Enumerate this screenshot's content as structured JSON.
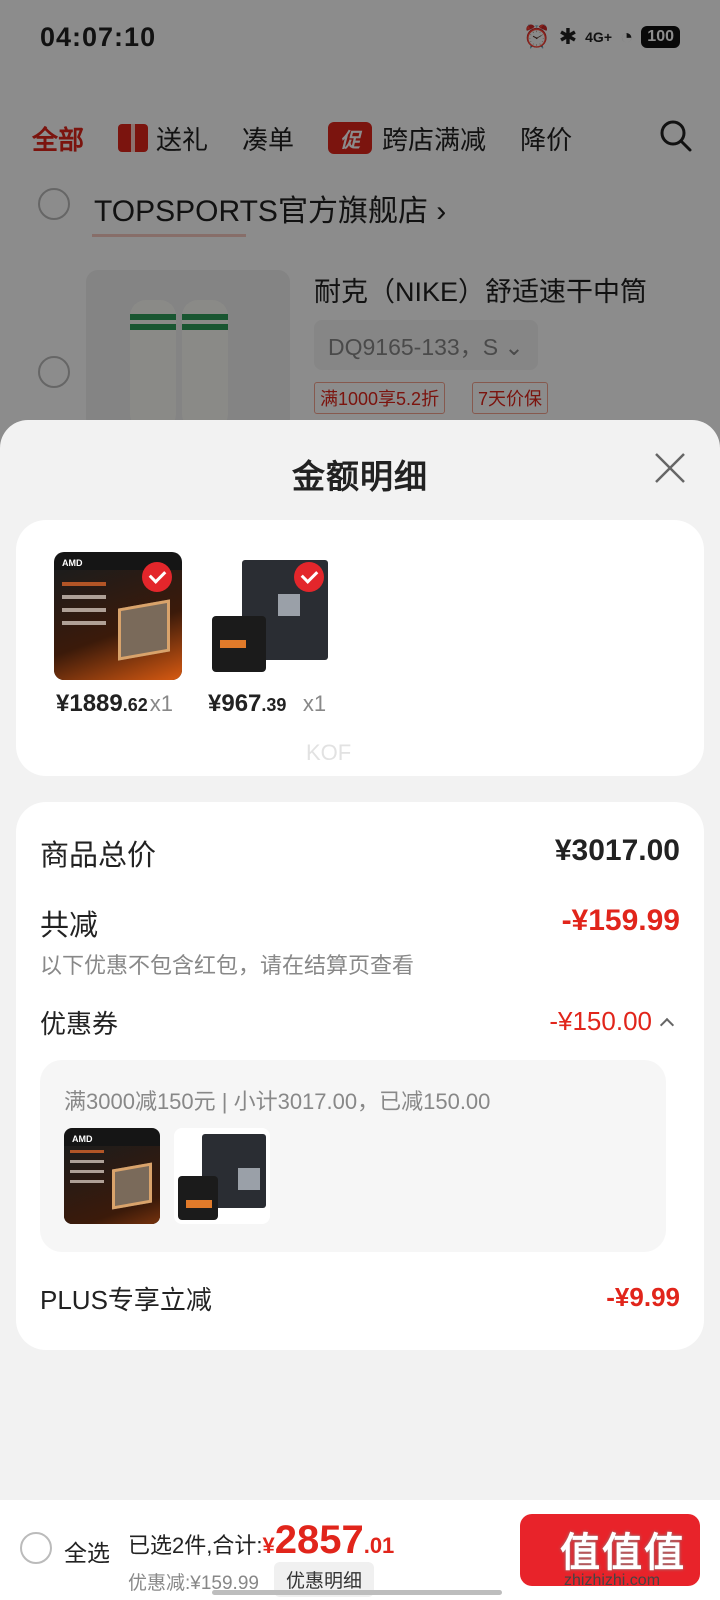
{
  "status_bar": {
    "time": "04:07:10",
    "battery": "100",
    "network": "4G+"
  },
  "top_tabs": [
    {
      "label": "全部"
    },
    {
      "label": "送礼"
    },
    {
      "label": "凑单"
    },
    {
      "label": "跨店满减",
      "badge": "促"
    },
    {
      "label": "降价"
    }
  ],
  "store": {
    "name": "TOPSPORTS官方旗舰店",
    "product_title": "耐克（NIKE）舒适速干中筒",
    "spec": "DQ9165-133，S",
    "tags": [
      "满1000享5.2折",
      "7天价保"
    ]
  },
  "sheet": {
    "title": "金额明细",
    "products": [
      {
        "price_main": "¥1889",
        "price_dec": ".62",
        "qty": "x1",
        "image_icon": "amd-cpu-box-image"
      },
      {
        "price_main": "¥967",
        "price_dec": ".39",
        "qty": "x1",
        "image_icon": "motherboard-image"
      }
    ],
    "watermark": "KOF",
    "total_label": "商品总价",
    "total_value": "¥3017.00",
    "discount_label": "共减",
    "discount_value": "-¥159.99",
    "discount_note": "以下优惠不包含红包，请在结算页查看",
    "coupon_label": "优惠券",
    "coupon_value": "-¥150.00",
    "coupon_desc": "满3000减150元 | 小计3017.00，已减150.00",
    "plus_label": "PLUS专享立减",
    "plus_value": "-¥9.99"
  },
  "bottom_bar": {
    "select_all": "全选",
    "summary_prefix": "已选2件,合计:",
    "currency": "¥",
    "amount_main": "2857",
    "amount_dec": ".01",
    "discount_note": "优惠减:¥159.99",
    "detail_button": "优惠明细"
  },
  "brand": {
    "mark": "值值值",
    "url": "zhizhizhi.com"
  },
  "colors": {
    "accent": "#e1251b",
    "sheet_bg": "#f2f2f2"
  }
}
